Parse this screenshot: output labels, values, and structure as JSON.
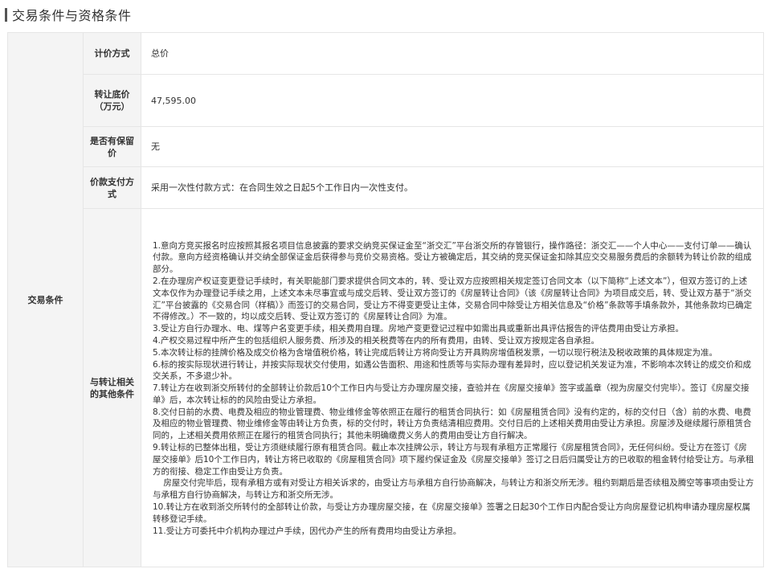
{
  "section": {
    "title": "交易条件与资格条件"
  },
  "category": "交易条件",
  "rows": [
    {
      "label": "计价方式",
      "value": "总价"
    },
    {
      "label": "转让底价（万元）",
      "value": "47,595.00"
    },
    {
      "label": "是否有保留价",
      "value": "无"
    },
    {
      "label": "价款支付方式",
      "value": "采用一次性付款方式：在合同生效之日起5个工作日内一次性支付。"
    }
  ],
  "other": {
    "label": "与转让相关的其他条件",
    "paragraphs": [
      "1.意向方竞买报名时应按照其报名项目信息披露的要求交纳竞买保证金至“浙交汇”平台浙交所的存管银行，操作路径：浙交汇——个人中心——支付订单——确认付款。意向方经资格确认并交纳全部保证金后获得参与竞价交易资格。受让方被确定后，其交纳的竞买保证金扣除其应交交易服务费后的余额转为转让价款的组成部分。",
      "2.在办理房产权证变更登记手续时，有关职能部门要求提供合同文本的，转、受让双方应按照相关规定签订合同文本（以下简称“上述文本”），但双方签订的上述文本仅作为办理登记手续之用，上述文本未尽事宜或与成交后转、受让双方签订的《房屋转让合同》（该《房屋转让合同》为项目成交后，转、受让双方基于“浙交汇”平台披露的《交易合同（样稿）》而签订的交易合同，受让方不得变更受让主体，交易合同中除受让方相关信息及“价格”条款等手填条款外，其他条款均已确定不得修改。）不一致的，均以成交后转、受让双方签订的《房屋转让合同》为准。",
      "3.受让方自行办理水、电、煤等户名变更手续，相关费用自理。房地产变更登记过程中如需出具或重新出具评估报告的评估费用由受让方承担。",
      "4.产权交易过程中所产生的包括组织人服务费、所涉及的相关税费等在内的所有费用，由转、受让双方按规定各自承担。",
      "5.本次转让标的挂牌价格及成交价格为含增值税价格，转让完成后转让方将向受让方开具购房增值税发票，一切以现行税法及税收政策的具体规定为准。",
      "6.标的按实际现状进行转让，并按实际现状交付使用，如遇公告面积、用途和性质等与实际办理有差异时，应以登记机关发证为准，不影响本次转让的成交价和成交关系，不多退少补。",
      "7.转让方在收到浙交所转付的全部转让价款后10个工作日内与受让方办理房屋交接，查验并在《房屋交接单》签字或盖章（视为房屋交付完毕）。签订《房屋交接单》后，本次转让标的的风险由受让方承担。",
      "8.交付日前的水费、电费及相应的物业管理费、物业维修金等依照正在履行的租赁合同执行：如《房屋租赁合同》没有约定的，标的交付日（含）前的水费、电费及相应的物业管理费、物业维修金等由转让方负责，标的交付时，转让方负责结清相应费用。交付日后的上述相关费用由受让方承担。房屋涉及继续履行原租赁合同的，上述相关费用依照正在履行的租赁合同执行；其他未明确缴费义务人的费用由受让方自行解决。",
      "9.转让标的已整体出租，受让方须继续履行原有租赁合同。截止本次挂牌公示，转让方与现有承租方正常履行《房屋租赁合同》，无任何纠纷。受让方在签订《房屋交接单》后10个工作日内，转让方将已收取的《房屋租赁合同》项下履约保证金及《房屋交接单》签订之日后归属受让方的已收取的租金转付给受让方。与承租方的衔接、稳定工作由受让方负责。",
      "    房屋交付完毕后，现有承租方或有对受让方相关诉求的，由受让方与承租方自行协商解决，与转让方和浙交所无涉。租约到期后是否续租及腾空等事项由受让方与承租方自行协商解决，与转让方和浙交所无涉。",
      "10.转让方在收到浙交所转付的全部转让价款，与受让方办理房屋交接，在《房屋交接单》签署之日起30个工作日内配合受让方向房屋登记机构申请办理房屋权属转移登记手续。",
      "11.受让方可委托中介机构办理过户手续，因代办产生的所有费用均由受让方承担。"
    ]
  }
}
